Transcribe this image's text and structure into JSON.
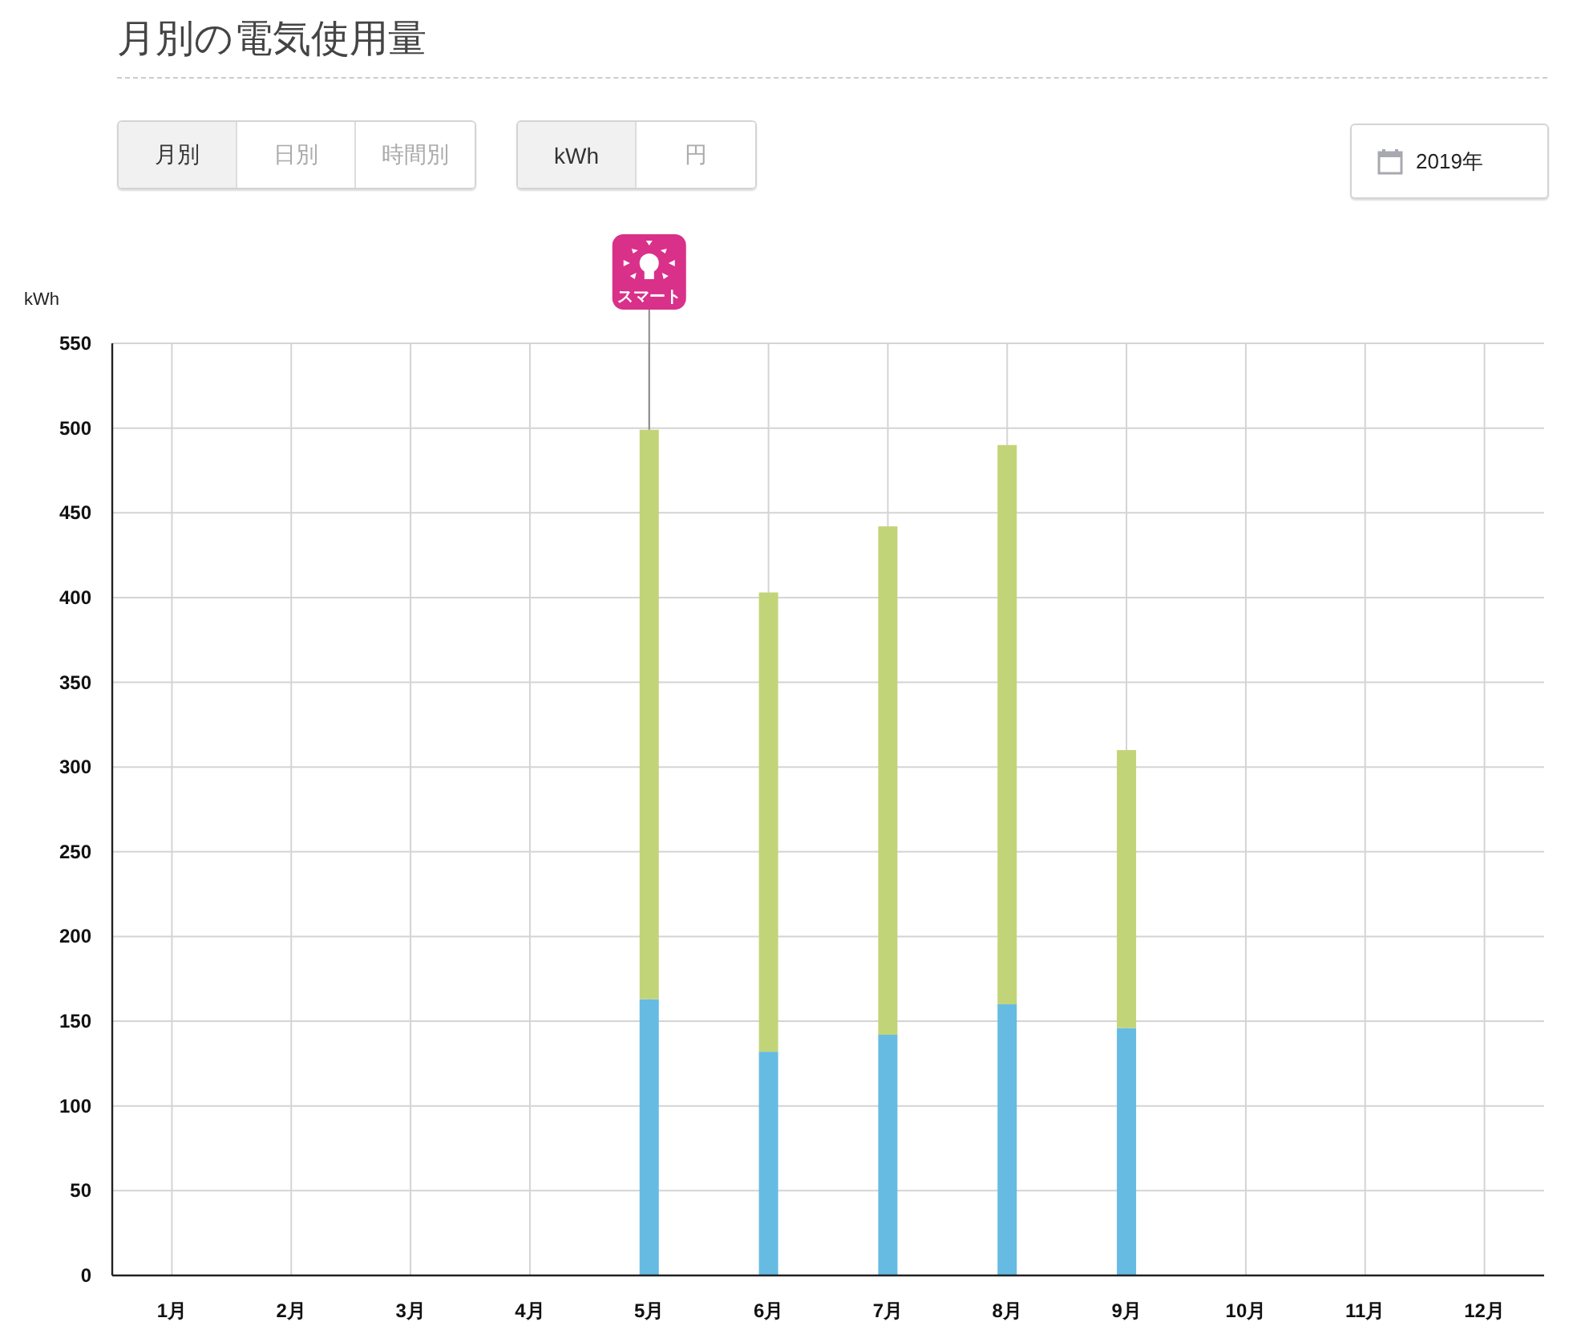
{
  "title": "月別の電気使用量",
  "period_tabs": [
    {
      "label": "月別",
      "selected": true
    },
    {
      "label": "日別",
      "selected": false
    },
    {
      "label": "時間別",
      "selected": false
    }
  ],
  "unit_tabs": [
    {
      "label": "kWh",
      "selected": true
    },
    {
      "label": "円",
      "selected": false
    }
  ],
  "year_button": {
    "label": "2019年"
  },
  "chart": {
    "chart_data": {
      "type": "bar",
      "ylabel": "kWh",
      "stacked": true,
      "categories": [
        "1月",
        "2月",
        "3月",
        "4月",
        "5月",
        "6月",
        "7月",
        "8月",
        "9月",
        "10月",
        "11月",
        "12月"
      ],
      "series": [
        {
          "color": "#66bbe3",
          "values": [
            null,
            null,
            null,
            null,
            163,
            132,
            142,
            160,
            146,
            null,
            null,
            null
          ]
        },
        {
          "color": "#c2d478",
          "values": [
            null,
            null,
            null,
            null,
            336,
            271,
            300,
            330,
            164,
            null,
            null,
            null
          ]
        }
      ],
      "ylim": [
        0,
        550
      ],
      "yticks": [
        0,
        50,
        100,
        150,
        200,
        250,
        300,
        350,
        400,
        450,
        500,
        550
      ],
      "grid": true,
      "annotations": [
        "スマート"
      ]
    }
  }
}
